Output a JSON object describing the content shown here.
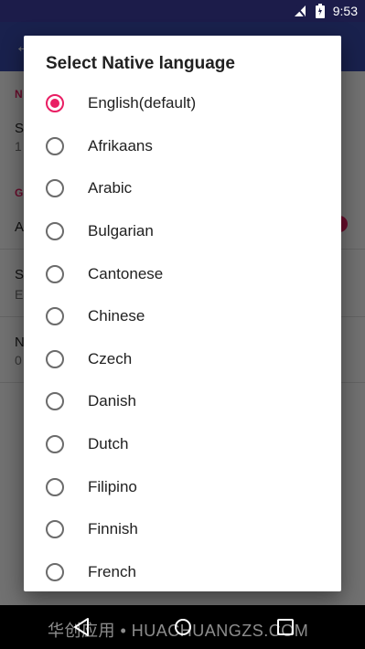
{
  "status_bar": {
    "time": "9:53",
    "icons": [
      "signal-off-icon",
      "battery-icon"
    ]
  },
  "background": {
    "section_a": "N",
    "row1_title": "S",
    "row1_sub": "1",
    "section_b": "G",
    "row2_title": "A",
    "row3_title": "S",
    "row3_sub": "En",
    "row4_title": "N",
    "row4_sub": "0"
  },
  "dialog": {
    "title": "Select Native language",
    "selected": "English(default)",
    "options": [
      {
        "label": "English(default)",
        "checked": true
      },
      {
        "label": "Afrikaans",
        "checked": false
      },
      {
        "label": "Arabic",
        "checked": false
      },
      {
        "label": "Bulgarian",
        "checked": false
      },
      {
        "label": "Cantonese",
        "checked": false
      },
      {
        "label": "Chinese",
        "checked": false
      },
      {
        "label": "Czech",
        "checked": false
      },
      {
        "label": "Danish",
        "checked": false
      },
      {
        "label": "Dutch",
        "checked": false
      },
      {
        "label": "Filipino",
        "checked": false
      },
      {
        "label": "Finnish",
        "checked": false
      },
      {
        "label": "French",
        "checked": false
      }
    ]
  },
  "nav_bar": {
    "buttons": [
      "back-icon",
      "home-icon",
      "recents-icon"
    ],
    "watermark": "华创应用 • HUACHUANGZS.COM"
  },
  "colors": {
    "accent": "#e91e63",
    "app_bar": "#3949ab",
    "status_bar": "#1c1c4a"
  }
}
